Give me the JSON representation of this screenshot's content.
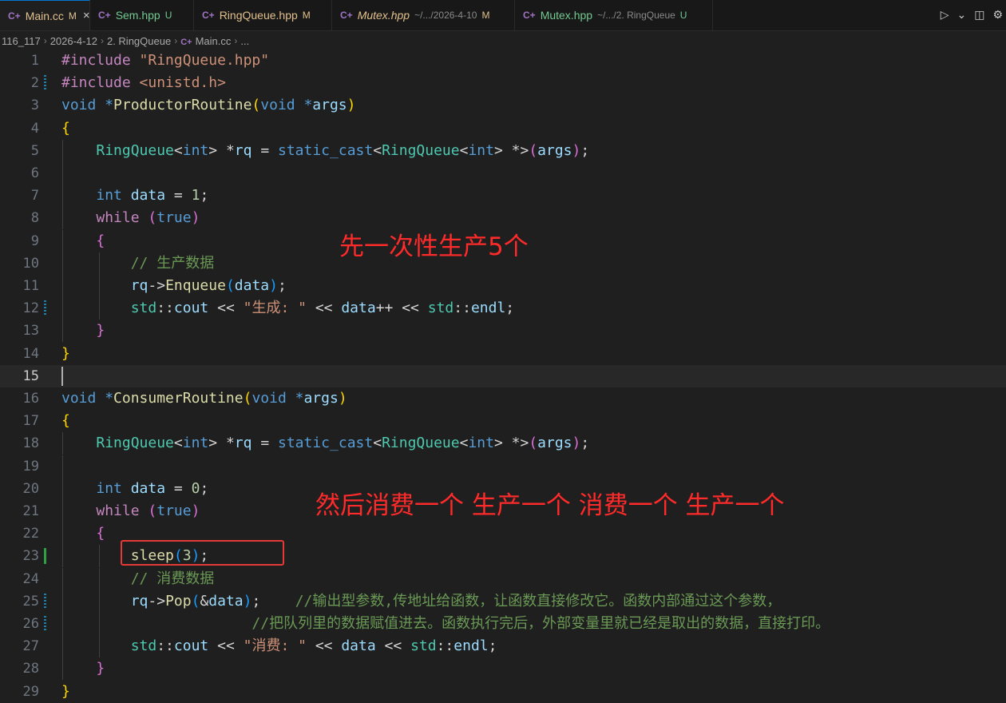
{
  "tabs": [
    {
      "name": "Main.cc",
      "status": "M",
      "active": true,
      "kind": "mod",
      "italic": false,
      "path": ""
    },
    {
      "name": "Sem.hpp",
      "status": "U",
      "active": false,
      "kind": "unt",
      "italic": false,
      "path": ""
    },
    {
      "name": "RingQueue.hpp",
      "status": "M",
      "active": false,
      "kind": "mod",
      "italic": false,
      "path": ""
    },
    {
      "name": "Mutex.hpp",
      "status": "M",
      "active": false,
      "kind": "mod",
      "italic": true,
      "path": "~/.../2026-4-10"
    },
    {
      "name": "Mutex.hpp",
      "status": "U",
      "active": false,
      "kind": "unt",
      "italic": false,
      "path": "~/.../2. RingQueue"
    }
  ],
  "tab_icon_glyph": "C+",
  "close_glyph": "×",
  "breadcrumb": {
    "items": [
      "116_117",
      "2026-4-12",
      "2. RingQueue",
      "Main.cc",
      "..."
    ]
  },
  "annotations": {
    "top": "先一次性生产5个",
    "bottom": "然后消费一个 生产一个 消费一个 生产一个"
  },
  "colors": {
    "annotation": "#ff2a2a",
    "accent": "#0078d4",
    "modified": "#e2c08d",
    "untracked": "#73c991"
  },
  "code": [
    {
      "n": 1,
      "m": "",
      "t": [
        [
          "#include ",
          "pre"
        ],
        [
          "\"RingQueue.hpp\"",
          "str"
        ]
      ]
    },
    {
      "n": 2,
      "m": "mod",
      "t": [
        [
          "#include ",
          "pre"
        ],
        [
          "<unistd.h>",
          "str"
        ]
      ]
    },
    {
      "n": 3,
      "m": "",
      "t": [
        [
          "void ",
          "kw"
        ],
        [
          "*",
          "kw"
        ],
        [
          "ProductorRoutine",
          "fn"
        ],
        [
          "(",
          "b1"
        ],
        [
          "void ",
          "kw"
        ],
        [
          "*",
          "kw"
        ],
        [
          "args",
          "var"
        ],
        [
          ")",
          "b1"
        ]
      ]
    },
    {
      "n": 4,
      "m": "",
      "t": [
        [
          "{",
          "b1"
        ]
      ]
    },
    {
      "n": 5,
      "m": "",
      "t": [
        [
          "    "
        ],
        [
          "RingQueue",
          "ty"
        ],
        [
          "<",
          "op"
        ],
        [
          "int",
          "kw"
        ],
        [
          "> ",
          "op"
        ],
        [
          "*",
          "op"
        ],
        [
          "rq",
          "var"
        ],
        [
          " = ",
          "op"
        ],
        [
          "static_cast",
          "kw"
        ],
        [
          "<",
          "op"
        ],
        [
          "RingQueue",
          "ty"
        ],
        [
          "<",
          "op"
        ],
        [
          "int",
          "kw"
        ],
        [
          "> *>",
          "op"
        ],
        [
          "(",
          "b2"
        ],
        [
          "args",
          "var"
        ],
        [
          ")",
          "b2"
        ],
        [
          ";",
          "op"
        ]
      ]
    },
    {
      "n": 6,
      "m": "",
      "t": []
    },
    {
      "n": 7,
      "m": "",
      "t": [
        [
          "    "
        ],
        [
          "int ",
          "kw"
        ],
        [
          "data",
          "var"
        ],
        [
          " = ",
          "op"
        ],
        [
          "1",
          "num"
        ],
        [
          ";",
          "op"
        ]
      ]
    },
    {
      "n": 8,
      "m": "",
      "t": [
        [
          "    "
        ],
        [
          "while ",
          "ctl"
        ],
        [
          "(",
          "b2"
        ],
        [
          "true",
          "kw"
        ],
        [
          ")",
          "b2"
        ]
      ]
    },
    {
      "n": 9,
      "m": "",
      "t": [
        [
          "    "
        ],
        [
          "{",
          "b2"
        ]
      ]
    },
    {
      "n": 10,
      "m": "",
      "t": [
        [
          "        "
        ],
        [
          "// 生产数据",
          "cm"
        ]
      ]
    },
    {
      "n": 11,
      "m": "",
      "t": [
        [
          "        "
        ],
        [
          "rq",
          "var"
        ],
        [
          "->",
          "op"
        ],
        [
          "Enqueue",
          "fn"
        ],
        [
          "(",
          "b3"
        ],
        [
          "data",
          "var"
        ],
        [
          ")",
          "b3"
        ],
        [
          ";",
          "op"
        ]
      ]
    },
    {
      "n": 12,
      "m": "mod",
      "t": [
        [
          "        "
        ],
        [
          "std",
          "ty"
        ],
        [
          "::",
          "op"
        ],
        [
          "cout",
          "var"
        ],
        [
          " << ",
          "op"
        ],
        [
          "\"生成: \"",
          "str"
        ],
        [
          " << ",
          "op"
        ],
        [
          "data",
          "var"
        ],
        [
          "++ << ",
          "op"
        ],
        [
          "std",
          "ty"
        ],
        [
          "::",
          "op"
        ],
        [
          "endl",
          "var"
        ],
        [
          ";",
          "op"
        ]
      ]
    },
    {
      "n": 13,
      "m": "",
      "t": [
        [
          "    "
        ],
        [
          "}",
          "b2"
        ]
      ]
    },
    {
      "n": 14,
      "m": "",
      "t": [
        [
          "}",
          "b1"
        ]
      ]
    },
    {
      "n": 15,
      "m": "",
      "t": [],
      "cur": true
    },
    {
      "n": 16,
      "m": "",
      "t": [
        [
          "void ",
          "kw"
        ],
        [
          "*",
          "kw"
        ],
        [
          "ConsumerRoutine",
          "fn"
        ],
        [
          "(",
          "b1"
        ],
        [
          "void ",
          "kw"
        ],
        [
          "*",
          "kw"
        ],
        [
          "args",
          "var"
        ],
        [
          ")",
          "b1"
        ]
      ]
    },
    {
      "n": 17,
      "m": "",
      "t": [
        [
          "{",
          "b1"
        ]
      ]
    },
    {
      "n": 18,
      "m": "",
      "t": [
        [
          "    "
        ],
        [
          "RingQueue",
          "ty"
        ],
        [
          "<",
          "op"
        ],
        [
          "int",
          "kw"
        ],
        [
          "> ",
          "op"
        ],
        [
          "*",
          "op"
        ],
        [
          "rq",
          "var"
        ],
        [
          " = ",
          "op"
        ],
        [
          "static_cast",
          "kw"
        ],
        [
          "<",
          "op"
        ],
        [
          "RingQueue",
          "ty"
        ],
        [
          "<",
          "op"
        ],
        [
          "int",
          "kw"
        ],
        [
          "> *>",
          "op"
        ],
        [
          "(",
          "b2"
        ],
        [
          "args",
          "var"
        ],
        [
          ")",
          "b2"
        ],
        [
          ";",
          "op"
        ]
      ]
    },
    {
      "n": 19,
      "m": "",
      "t": []
    },
    {
      "n": 20,
      "m": "",
      "t": [
        [
          "    "
        ],
        [
          "int ",
          "kw"
        ],
        [
          "data",
          "var"
        ],
        [
          " = ",
          "op"
        ],
        [
          "0",
          "num"
        ],
        [
          ";",
          "op"
        ]
      ]
    },
    {
      "n": 21,
      "m": "",
      "t": [
        [
          "    "
        ],
        [
          "while ",
          "ctl"
        ],
        [
          "(",
          "b2"
        ],
        [
          "true",
          "kw"
        ],
        [
          ")",
          "b2"
        ]
      ]
    },
    {
      "n": 22,
      "m": "",
      "t": [
        [
          "    "
        ],
        [
          "{",
          "b2"
        ]
      ]
    },
    {
      "n": 23,
      "m": "add",
      "t": [
        [
          "        "
        ],
        [
          "sleep",
          "fn"
        ],
        [
          "(",
          "b3"
        ],
        [
          "3",
          "num"
        ],
        [
          ")",
          "b3"
        ],
        [
          ";",
          "op"
        ]
      ]
    },
    {
      "n": 24,
      "m": "",
      "t": [
        [
          "        "
        ],
        [
          "// 消费数据",
          "cm"
        ]
      ]
    },
    {
      "n": 25,
      "m": "mod",
      "t": [
        [
          "        "
        ],
        [
          "rq",
          "var"
        ],
        [
          "->",
          "op"
        ],
        [
          "Pop",
          "fn"
        ],
        [
          "(",
          "b3"
        ],
        [
          "&",
          "op"
        ],
        [
          "data",
          "var"
        ],
        [
          ")",
          "b3"
        ],
        [
          ";",
          "op"
        ],
        [
          "    "
        ],
        [
          "//输出型参数,传地址给函数，让函数直接修改它。函数内部通过这个参数，",
          "cm"
        ]
      ]
    },
    {
      "n": 26,
      "m": "mod",
      "t": [
        [
          "                      "
        ],
        [
          "//把队列里的数据赋值进去。函数执行完后，外部变量里就已经是取出的数据，直接打印。",
          "cm"
        ]
      ]
    },
    {
      "n": 27,
      "m": "",
      "t": [
        [
          "        "
        ],
        [
          "std",
          "ty"
        ],
        [
          "::",
          "op"
        ],
        [
          "cout",
          "var"
        ],
        [
          " << ",
          "op"
        ],
        [
          "\"消费: \"",
          "str"
        ],
        [
          " << ",
          "op"
        ],
        [
          "data",
          "var"
        ],
        [
          " << ",
          "op"
        ],
        [
          "std",
          "ty"
        ],
        [
          "::",
          "op"
        ],
        [
          "endl",
          "var"
        ],
        [
          ";",
          "op"
        ]
      ]
    },
    {
      "n": 28,
      "m": "",
      "t": [
        [
          "    "
        ],
        [
          "}",
          "b2"
        ]
      ]
    },
    {
      "n": 29,
      "m": "",
      "t": [
        [
          "}",
          "b1"
        ]
      ]
    }
  ]
}
